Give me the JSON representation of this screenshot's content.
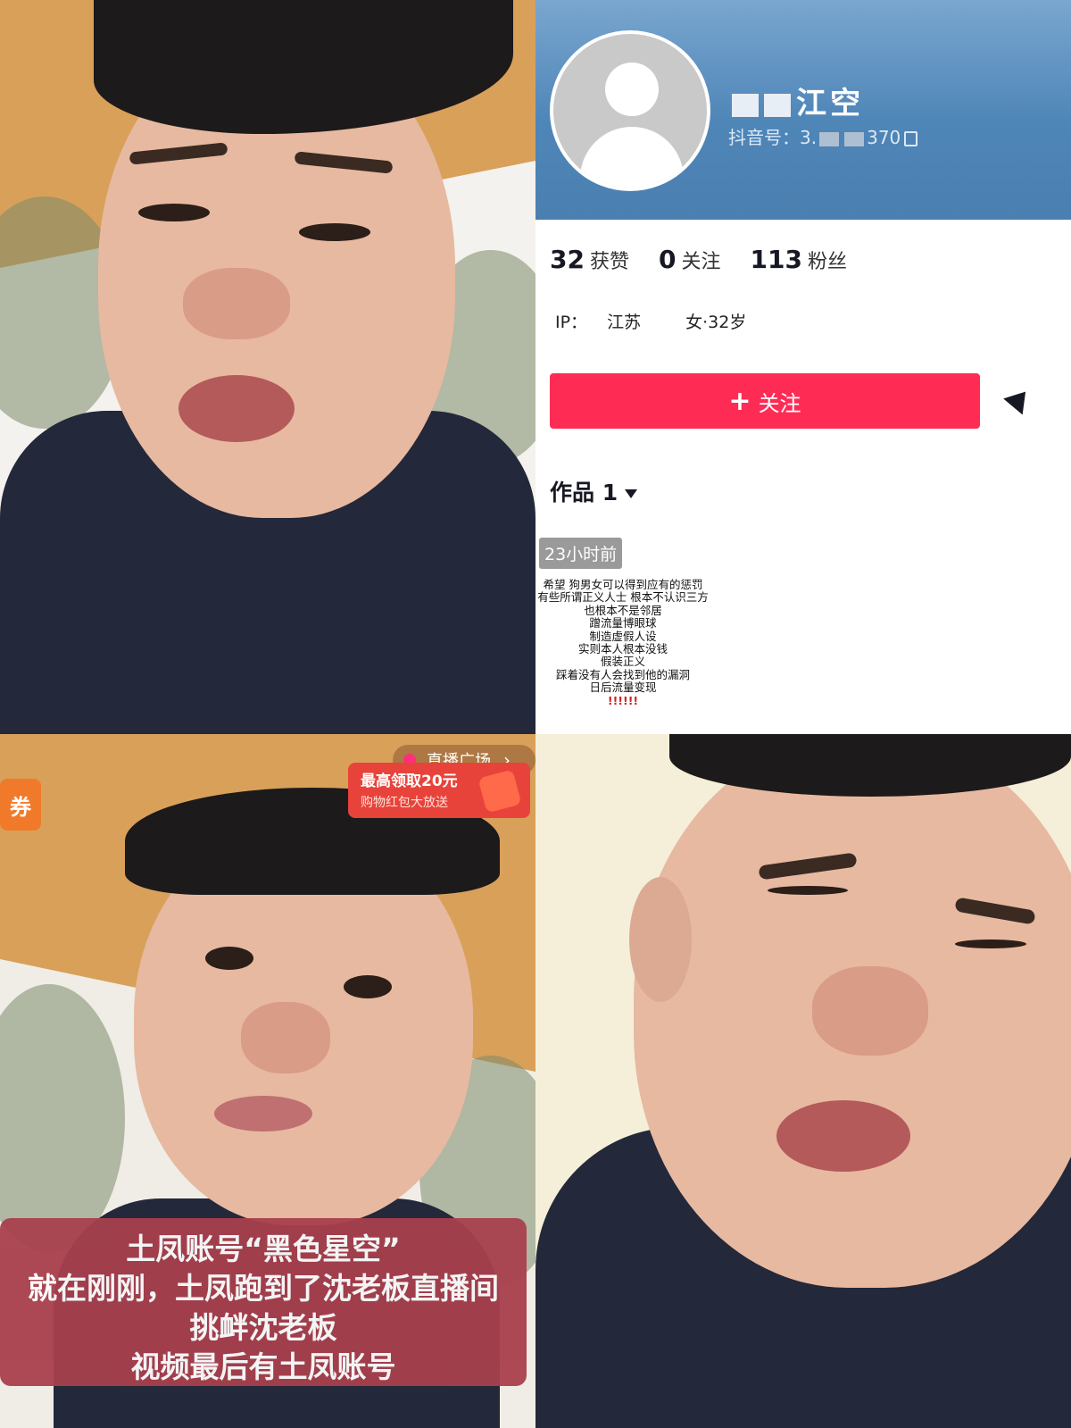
{
  "profile": {
    "nickname_visible": "江空",
    "douyin_id_prefix": "抖音号：3.",
    "douyin_id_suffix": "370",
    "stats": [
      {
        "num": "32",
        "label": "获赞"
      },
      {
        "num": "0",
        "label": "关注"
      },
      {
        "num": "113",
        "label": "粉丝"
      }
    ],
    "ip_label": "IP：",
    "ip_value": "江苏",
    "gender_age": "女·32岁",
    "follow_label": "关注",
    "follow_plus": "+",
    "works_label": "作品 1",
    "video": {
      "time": "23小时前",
      "lines": [
        "希望 狗男女可以得到应有的惩罚",
        "有些所谓正义人士 根本不认识三方",
        "也根本不是邻居",
        "蹭流量博眼球",
        "制造虚假人设",
        "实则本人根本没钱",
        "假装正义",
        "踩着没有人会找到他的漏洞",
        "日后流量变现"
      ],
      "exclaim": "!!!!!!"
    }
  },
  "live": {
    "plaza_label": "直播广场",
    "plaza_chevron": "›",
    "coupon_label": "券",
    "redpack_title": "最高领取20元",
    "redpack_sub": "购物红包大放送",
    "caption_lines": [
      "土凤账号“黑色星空”",
      "就在刚刚，土凤跑到了沈老板直播间",
      "挑衅沈老板",
      "视频最后有土凤账号"
    ]
  },
  "colors": {
    "follow_button": "#fe2c55",
    "caption_bg": "#a8404d",
    "banner": "#4f86b8"
  }
}
